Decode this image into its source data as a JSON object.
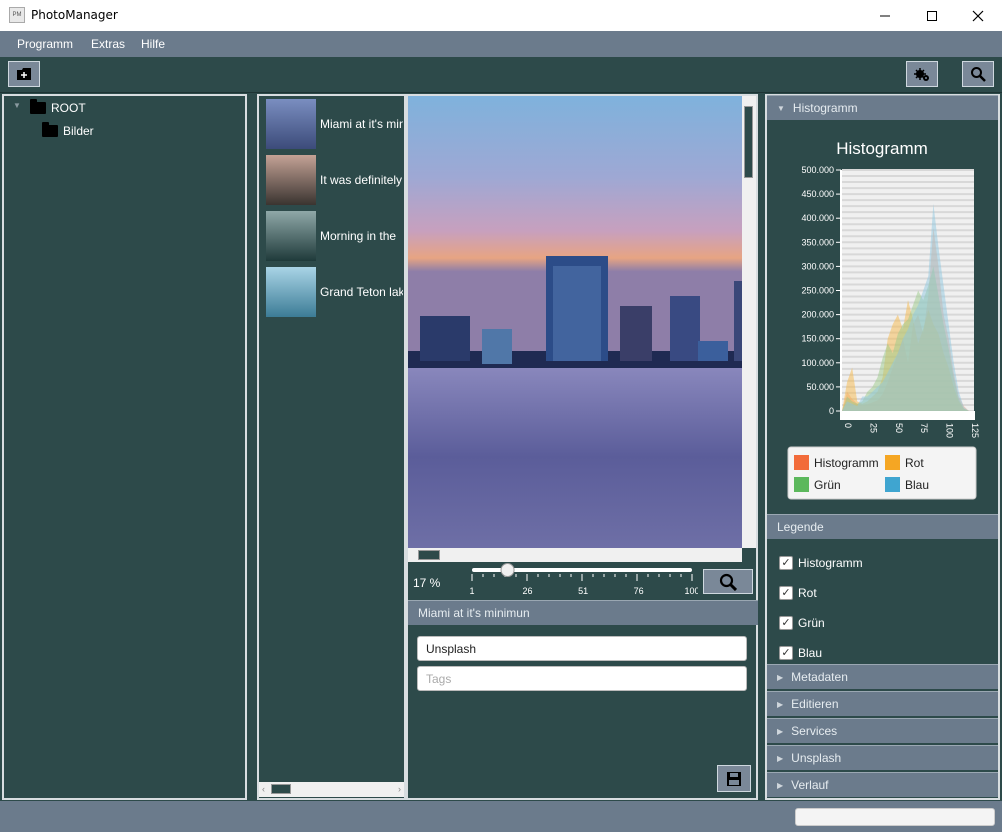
{
  "window": {
    "title": "PhotoManager",
    "icon_text": "PM"
  },
  "menu": [
    "Programm",
    "Extras",
    "Hilfe"
  ],
  "tree": {
    "root": "ROOT",
    "child": "Bilder"
  },
  "photos": [
    {
      "label": "Miami at it's minimun",
      "colors": [
        "#7a8ec0",
        "#3c4b7a"
      ]
    },
    {
      "label": "It was definitely",
      "colors": [
        "#c4a296",
        "#3a3430"
      ]
    },
    {
      "label": "Morning in the",
      "colors": [
        "#8fa8a8",
        "#1f3a3a"
      ]
    },
    {
      "label": "Grand Teton lake",
      "colors": [
        "#a9d4e6",
        "#3c7c96"
      ]
    }
  ],
  "viewer": {
    "zoom_label": "17 %",
    "slider_value": 17,
    "slider_min": 1,
    "slider_max": 100,
    "slider_ticks": [
      "1",
      "26",
      "51",
      "76",
      "100"
    ]
  },
  "details": {
    "title": "Miami at it's minimun",
    "source_value": "Unsplash",
    "tags_placeholder": "Tags"
  },
  "chart_data": {
    "type": "area",
    "title": "Histogramm",
    "xlabel": "",
    "ylabel": "",
    "xlim": [
      0,
      130
    ],
    "ylim": [
      0,
      500000
    ],
    "xticks": [
      "0",
      "25",
      "50",
      "75",
      "100",
      "125"
    ],
    "yticks": [
      "0",
      "50.000",
      "100.000",
      "150.000",
      "200.000",
      "250.000",
      "300.000",
      "350.000",
      "400.000",
      "450.000",
      "500.000"
    ],
    "x": [
      0,
      5,
      10,
      15,
      20,
      25,
      30,
      35,
      40,
      45,
      50,
      55,
      60,
      65,
      70,
      75,
      80,
      85,
      90,
      95,
      100,
      105,
      110,
      115,
      120,
      125
    ],
    "series": [
      {
        "name": "Histogramm",
        "color": "#f4a582",
        "values": [
          0,
          40000,
          25000,
          15000,
          12000,
          14000,
          18000,
          22000,
          35000,
          60000,
          90000,
          120000,
          150000,
          100000,
          180000,
          200000,
          160000,
          240000,
          380000,
          300000,
          200000,
          150000,
          80000,
          30000,
          10000,
          0
        ]
      },
      {
        "name": "Rot",
        "color": "#f5b84a",
        "values": [
          0,
          60000,
          90000,
          20000,
          15000,
          20000,
          30000,
          40000,
          70000,
          150000,
          180000,
          200000,
          170000,
          230000,
          190000,
          140000,
          170000,
          210000,
          180000,
          160000,
          120000,
          90000,
          50000,
          20000,
          5000,
          0
        ]
      },
      {
        "name": "Grün",
        "color": "#9cc98a",
        "values": [
          0,
          30000,
          20000,
          15000,
          20000,
          40000,
          50000,
          70000,
          110000,
          140000,
          120000,
          160000,
          180000,
          190000,
          220000,
          250000,
          230000,
          260000,
          300000,
          240000,
          180000,
          130000,
          70000,
          25000,
          5000,
          0
        ]
      },
      {
        "name": "Blau",
        "color": "#8fc7e0",
        "values": [
          0,
          20000,
          15000,
          10000,
          30000,
          30000,
          40000,
          50000,
          60000,
          80000,
          100000,
          120000,
          150000,
          170000,
          200000,
          220000,
          250000,
          280000,
          430000,
          340000,
          260000,
          180000,
          100000,
          40000,
          8000,
          0
        ]
      }
    ],
    "legend": [
      {
        "name": "Histogramm",
        "color": "#f26b3a"
      },
      {
        "name": "Rot",
        "color": "#f5a623"
      },
      {
        "name": "Grün",
        "color": "#5cb85c"
      },
      {
        "name": "Blau",
        "color": "#3fa5d0"
      }
    ],
    "legend_position": "bottom",
    "grid": true
  },
  "accordion": {
    "histogram": "Histogramm",
    "legend": "Legende",
    "checks": [
      "Histogramm",
      "Rot",
      "Grün",
      "Blau"
    ],
    "collapsed": [
      "Metadaten",
      "Editieren",
      "Services",
      "Unsplash",
      "Verlauf"
    ]
  }
}
